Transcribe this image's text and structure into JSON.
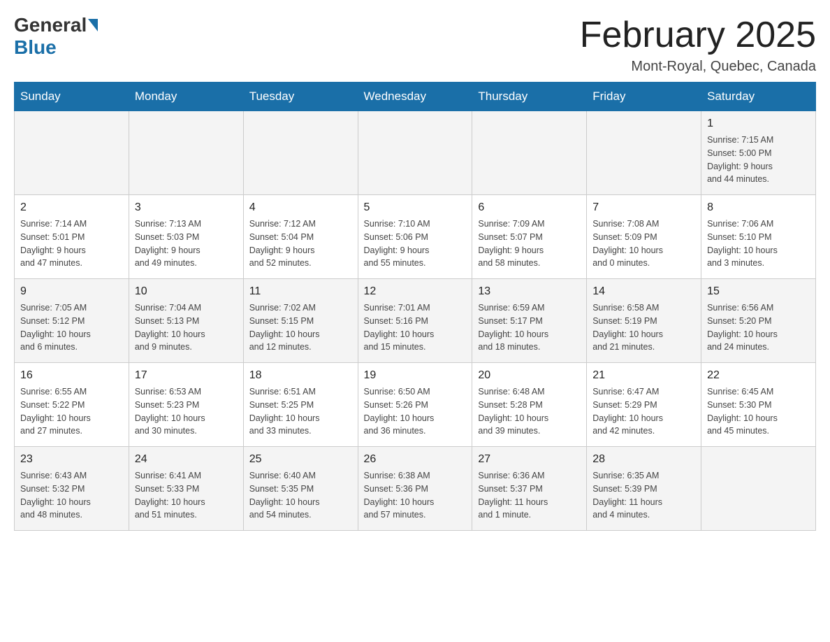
{
  "header": {
    "logo_general": "General",
    "logo_blue": "Blue",
    "title": "February 2025",
    "subtitle": "Mont-Royal, Quebec, Canada"
  },
  "days_of_week": [
    "Sunday",
    "Monday",
    "Tuesday",
    "Wednesday",
    "Thursday",
    "Friday",
    "Saturday"
  ],
  "weeks": [
    {
      "days": [
        {
          "num": "",
          "info": ""
        },
        {
          "num": "",
          "info": ""
        },
        {
          "num": "",
          "info": ""
        },
        {
          "num": "",
          "info": ""
        },
        {
          "num": "",
          "info": ""
        },
        {
          "num": "",
          "info": ""
        },
        {
          "num": "1",
          "info": "Sunrise: 7:15 AM\nSunset: 5:00 PM\nDaylight: 9 hours\nand 44 minutes."
        }
      ]
    },
    {
      "days": [
        {
          "num": "2",
          "info": "Sunrise: 7:14 AM\nSunset: 5:01 PM\nDaylight: 9 hours\nand 47 minutes."
        },
        {
          "num": "3",
          "info": "Sunrise: 7:13 AM\nSunset: 5:03 PM\nDaylight: 9 hours\nand 49 minutes."
        },
        {
          "num": "4",
          "info": "Sunrise: 7:12 AM\nSunset: 5:04 PM\nDaylight: 9 hours\nand 52 minutes."
        },
        {
          "num": "5",
          "info": "Sunrise: 7:10 AM\nSunset: 5:06 PM\nDaylight: 9 hours\nand 55 minutes."
        },
        {
          "num": "6",
          "info": "Sunrise: 7:09 AM\nSunset: 5:07 PM\nDaylight: 9 hours\nand 58 minutes."
        },
        {
          "num": "7",
          "info": "Sunrise: 7:08 AM\nSunset: 5:09 PM\nDaylight: 10 hours\nand 0 minutes."
        },
        {
          "num": "8",
          "info": "Sunrise: 7:06 AM\nSunset: 5:10 PM\nDaylight: 10 hours\nand 3 minutes."
        }
      ]
    },
    {
      "days": [
        {
          "num": "9",
          "info": "Sunrise: 7:05 AM\nSunset: 5:12 PM\nDaylight: 10 hours\nand 6 minutes."
        },
        {
          "num": "10",
          "info": "Sunrise: 7:04 AM\nSunset: 5:13 PM\nDaylight: 10 hours\nand 9 minutes."
        },
        {
          "num": "11",
          "info": "Sunrise: 7:02 AM\nSunset: 5:15 PM\nDaylight: 10 hours\nand 12 minutes."
        },
        {
          "num": "12",
          "info": "Sunrise: 7:01 AM\nSunset: 5:16 PM\nDaylight: 10 hours\nand 15 minutes."
        },
        {
          "num": "13",
          "info": "Sunrise: 6:59 AM\nSunset: 5:17 PM\nDaylight: 10 hours\nand 18 minutes."
        },
        {
          "num": "14",
          "info": "Sunrise: 6:58 AM\nSunset: 5:19 PM\nDaylight: 10 hours\nand 21 minutes."
        },
        {
          "num": "15",
          "info": "Sunrise: 6:56 AM\nSunset: 5:20 PM\nDaylight: 10 hours\nand 24 minutes."
        }
      ]
    },
    {
      "days": [
        {
          "num": "16",
          "info": "Sunrise: 6:55 AM\nSunset: 5:22 PM\nDaylight: 10 hours\nand 27 minutes."
        },
        {
          "num": "17",
          "info": "Sunrise: 6:53 AM\nSunset: 5:23 PM\nDaylight: 10 hours\nand 30 minutes."
        },
        {
          "num": "18",
          "info": "Sunrise: 6:51 AM\nSunset: 5:25 PM\nDaylight: 10 hours\nand 33 minutes."
        },
        {
          "num": "19",
          "info": "Sunrise: 6:50 AM\nSunset: 5:26 PM\nDaylight: 10 hours\nand 36 minutes."
        },
        {
          "num": "20",
          "info": "Sunrise: 6:48 AM\nSunset: 5:28 PM\nDaylight: 10 hours\nand 39 minutes."
        },
        {
          "num": "21",
          "info": "Sunrise: 6:47 AM\nSunset: 5:29 PM\nDaylight: 10 hours\nand 42 minutes."
        },
        {
          "num": "22",
          "info": "Sunrise: 6:45 AM\nSunset: 5:30 PM\nDaylight: 10 hours\nand 45 minutes."
        }
      ]
    },
    {
      "days": [
        {
          "num": "23",
          "info": "Sunrise: 6:43 AM\nSunset: 5:32 PM\nDaylight: 10 hours\nand 48 minutes."
        },
        {
          "num": "24",
          "info": "Sunrise: 6:41 AM\nSunset: 5:33 PM\nDaylight: 10 hours\nand 51 minutes."
        },
        {
          "num": "25",
          "info": "Sunrise: 6:40 AM\nSunset: 5:35 PM\nDaylight: 10 hours\nand 54 minutes."
        },
        {
          "num": "26",
          "info": "Sunrise: 6:38 AM\nSunset: 5:36 PM\nDaylight: 10 hours\nand 57 minutes."
        },
        {
          "num": "27",
          "info": "Sunrise: 6:36 AM\nSunset: 5:37 PM\nDaylight: 11 hours\nand 1 minute."
        },
        {
          "num": "28",
          "info": "Sunrise: 6:35 AM\nSunset: 5:39 PM\nDaylight: 11 hours\nand 4 minutes."
        },
        {
          "num": "",
          "info": ""
        }
      ]
    }
  ]
}
